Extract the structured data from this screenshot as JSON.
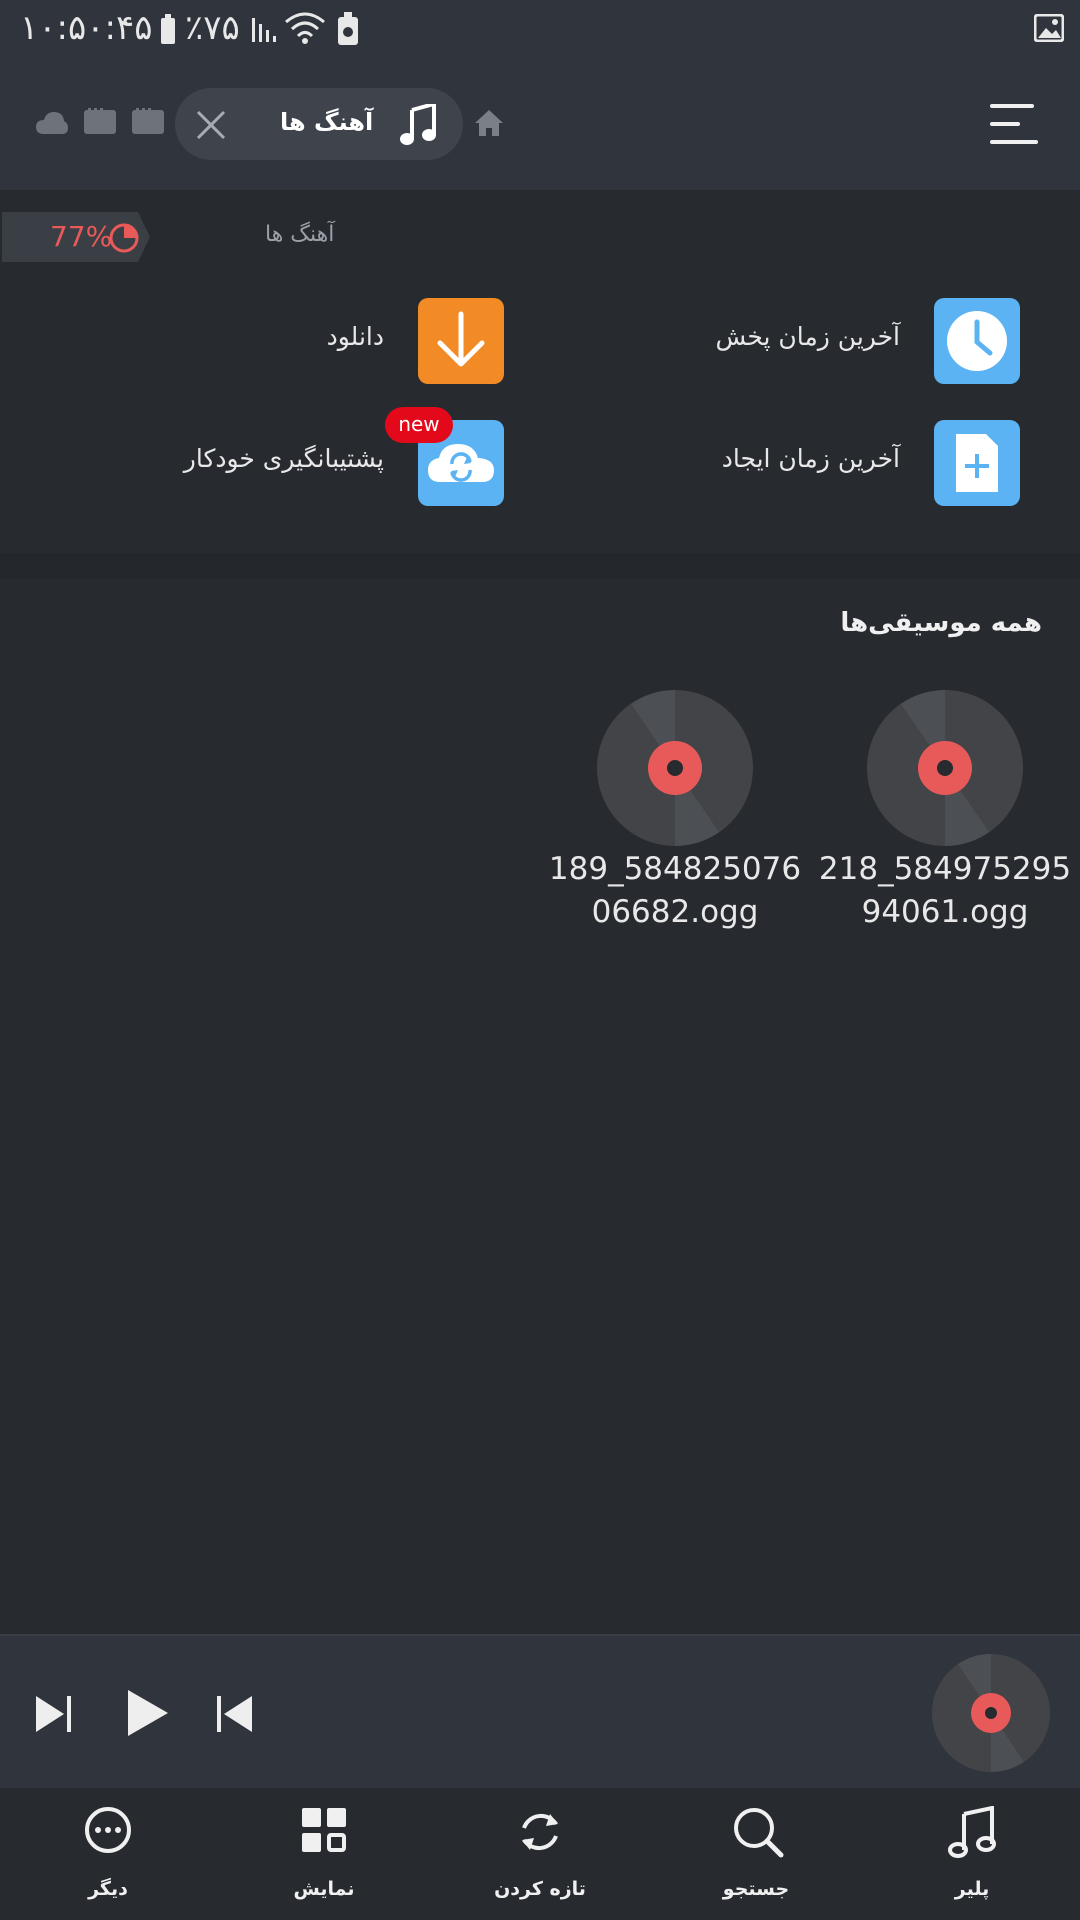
{
  "status_bar": {
    "time": "۱۰:۵۰:۴۵",
    "battery_percent": "٪۷۵",
    "icons": [
      "battery-icon",
      "signal-icon",
      "wifi-icon",
      "battery-saver-icon",
      "gallery-icon"
    ]
  },
  "header": {
    "active_tab": {
      "label": "آهنگ ها",
      "icon": "music-note-icon"
    },
    "icons": [
      "menu-icon",
      "home-icon",
      "close-icon",
      "storage-icon",
      "storage-icon",
      "cloud-icon"
    ]
  },
  "breadcrumb": {
    "storage_percent": "77%",
    "path": "آهنگ ها"
  },
  "quick_access": [
    {
      "label": "آخرین زمان پخش",
      "icon": "clock-icon",
      "color": "#5bb3f3"
    },
    {
      "label": "دانلود",
      "icon": "download-icon",
      "color": "#f28b25"
    },
    {
      "label": "آخرین زمان ایجاد",
      "icon": "new-file-icon",
      "color": "#5bb3f3"
    },
    {
      "label": "پشتیبانگیری خودکار",
      "icon": "cloud-sync-icon",
      "color": "#5bb3f3",
      "badge": "new"
    }
  ],
  "section": {
    "title": "همه موسیقی‌ها"
  },
  "files": [
    {
      "name": "218_58497529594061.ogg",
      "icon": "vinyl-disc-icon"
    },
    {
      "name": "189_58482507606682.ogg",
      "icon": "vinyl-disc-icon"
    }
  ],
  "player": {
    "icons": [
      "next-icon",
      "play-icon",
      "previous-icon",
      "vinyl-disc-icon"
    ]
  },
  "bottom_nav": [
    {
      "label": "پلیر",
      "icon": "music-note-icon"
    },
    {
      "label": "جستجو",
      "icon": "search-icon"
    },
    {
      "label": "تازه کردن",
      "icon": "refresh-icon"
    },
    {
      "label": "نمایش",
      "icon": "grid-view-icon"
    },
    {
      "label": "دیگر",
      "icon": "more-icon"
    }
  ],
  "colors": {
    "background": "#272a2f",
    "header": "#30343d",
    "accent_red": "#e85a5a",
    "new_badge": "#e3091b"
  }
}
